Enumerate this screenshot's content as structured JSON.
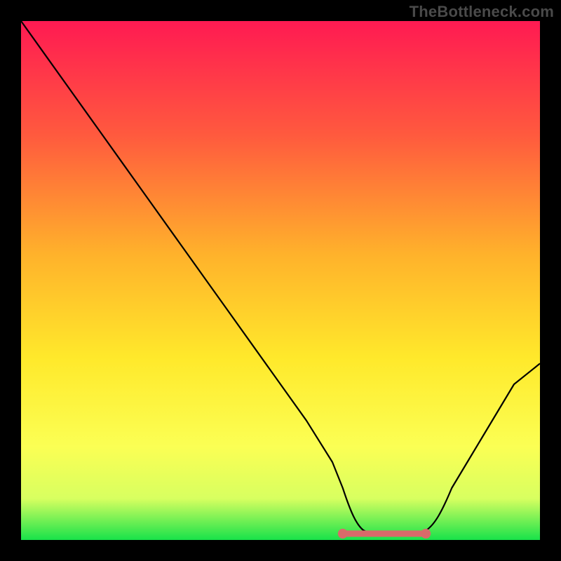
{
  "watermark": "TheBottleneck.com",
  "chart_data": {
    "type": "line",
    "title": "",
    "xlabel": "",
    "ylabel": "",
    "xlim": [
      0,
      100
    ],
    "ylim": [
      0,
      100
    ],
    "x": [
      0,
      5,
      10,
      15,
      20,
      25,
      30,
      35,
      40,
      45,
      50,
      55,
      60,
      62,
      65,
      68,
      70,
      72,
      75,
      78,
      80,
      83,
      86,
      89,
      92,
      95,
      100
    ],
    "values": [
      100,
      93,
      86,
      79,
      72,
      65,
      58,
      51,
      44,
      37,
      30,
      23,
      15,
      10,
      6,
      3,
      1.5,
      1,
      1,
      1.5,
      3,
      6,
      10,
      15,
      20,
      25,
      34
    ],
    "annotations": [
      {
        "label": "flat-min-marker",
        "x_start": 62,
        "x_end": 78,
        "y": 1.2,
        "color": "#d96a6a"
      }
    ],
    "background_gradient": {
      "top_color": "#ff1a52",
      "mid_colors": [
        "#ff6b3a",
        "#ffc92b",
        "#ffff3a",
        "#f8ff6a"
      ],
      "bottom_color": "#18e24a"
    }
  }
}
